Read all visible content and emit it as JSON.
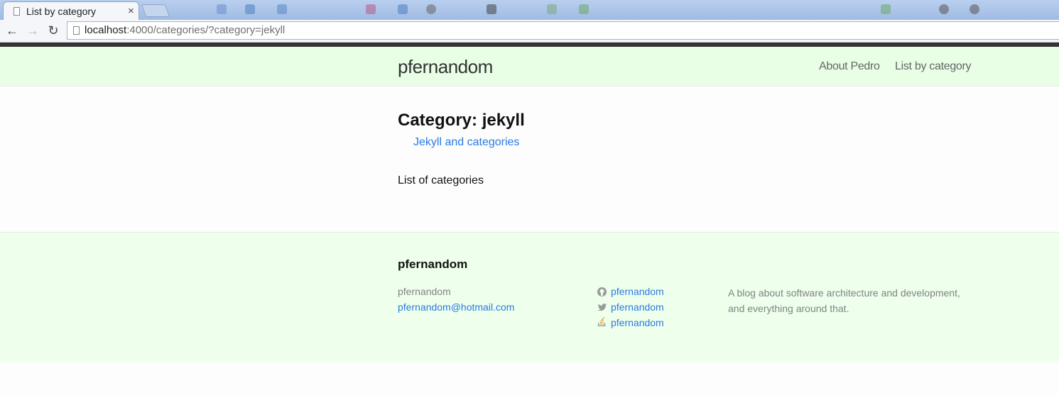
{
  "browser": {
    "tab_title": "List by category",
    "tab_close": "×",
    "url_host": "localhost",
    "url_rest": ":4000/categories/?category=jekyll",
    "icons": {
      "back": "back-arrow-icon",
      "forward": "forward-arrow-icon",
      "reload": "reload-icon",
      "page": "page-icon"
    }
  },
  "header": {
    "site_title": "pfernandom",
    "nav": [
      {
        "label": "About Pedro"
      },
      {
        "label": "List by category"
      }
    ]
  },
  "main": {
    "heading": "Category: jekyll",
    "posts": [
      {
        "title": "Jekyll and categories"
      }
    ],
    "categories_label": "List of categories"
  },
  "footer": {
    "heading": "pfernandom",
    "name": "pfernandom",
    "email": "pfernandom@hotmail.com",
    "social": [
      {
        "icon": "github-icon",
        "label": "pfernandom"
      },
      {
        "icon": "twitter-icon",
        "label": "pfernandom"
      },
      {
        "icon": "stackoverflow-icon",
        "label": "pfernandom"
      }
    ],
    "description": "A blog about software architecture and development, and everything around that."
  },
  "colors": {
    "header_bg": "#e8ffe6",
    "footer_bg": "#eeffec",
    "link": "#2a7ae2",
    "muted_text": "#828282"
  }
}
